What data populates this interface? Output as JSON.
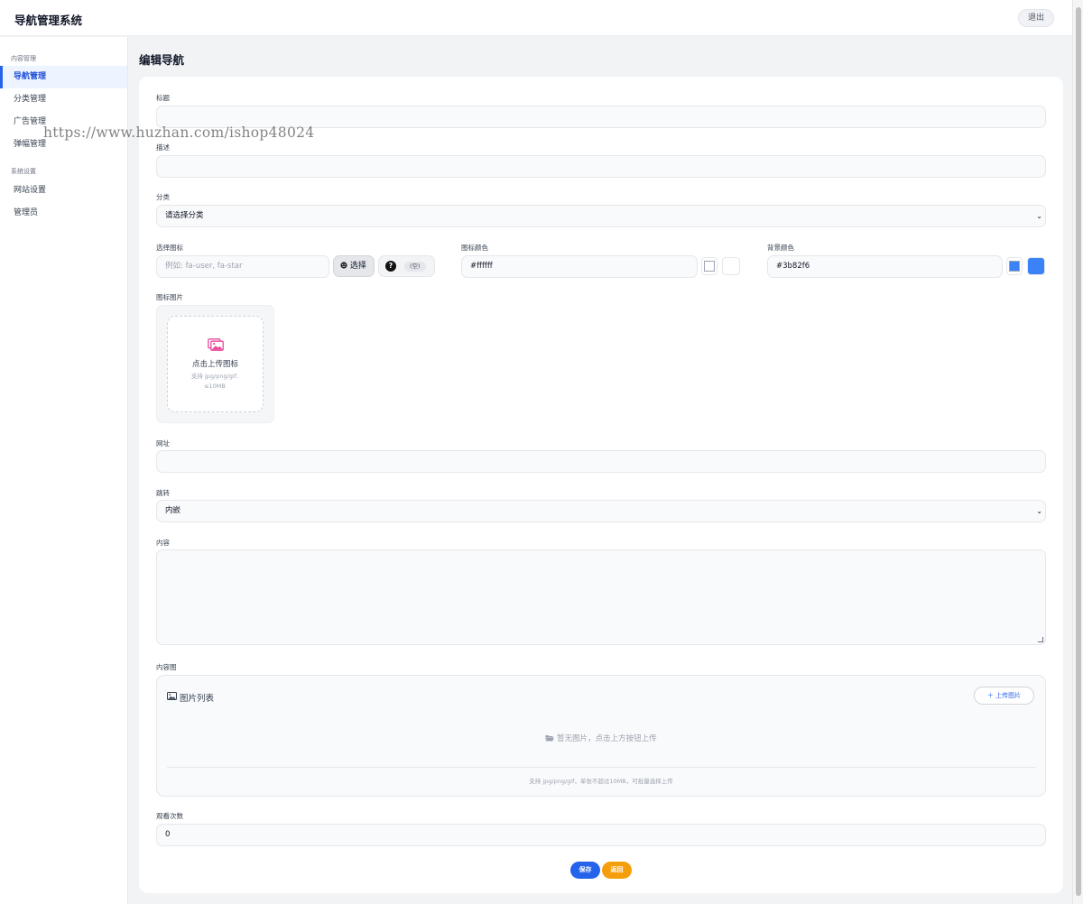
{
  "app": {
    "title": "导航管理系统",
    "logout_label": "退出"
  },
  "sidebar": {
    "groups": [
      {
        "label": "内容管理",
        "items": [
          {
            "label": "导航管理",
            "active": true
          },
          {
            "label": "分类管理"
          },
          {
            "label": "广告管理"
          },
          {
            "label": "弹幅管理"
          }
        ]
      },
      {
        "label": "系统设置",
        "items": [
          {
            "label": "网站设置"
          },
          {
            "label": "管理员"
          }
        ]
      }
    ]
  },
  "watermark": "https://www.huzhan.com/ishop48024",
  "page": {
    "title": "编辑导航"
  },
  "form": {
    "title_label": "标题",
    "title_value": "",
    "desc_label": "描述",
    "desc_value": "",
    "category_label": "分类",
    "category_value": "请选择分类",
    "icon_label": "选择图标",
    "icon_placeholder": "例如: fa-user, fa-star",
    "icon_select_label": "选择",
    "icon_preview_text": "(空)",
    "icon_color_label": "图标颜色",
    "icon_color_value": "#ffffff",
    "icon_color_swatch": "#ffffff",
    "bg_color_label": "背景颜色",
    "bg_color_value": "#3b82f6",
    "bg_color_swatch": "#3b82f6",
    "icon_image_label": "图标图片",
    "upload_text": "点击上传图标",
    "upload_hint": "支持 jpg/png/gif, ≤10MB",
    "url_label": "网址",
    "url_value": "",
    "jump_label": "跳转",
    "jump_value": "内嵌",
    "content_label": "内容",
    "content_images_label": "内容图",
    "gallery_title": "图片列表",
    "gallery_upload_label": "上传图片",
    "gallery_empty": "暂无图片，点击上方按钮上传",
    "gallery_hint": "支持 jpg/png/gif，单张不超过10MB，可批量选择上传",
    "views_label": "观看次数",
    "views_value": "0"
  },
  "actions": {
    "save_label": "保存",
    "back_label": "返回"
  },
  "colors": {
    "primary": "#2563eb",
    "warning": "#f59e0b",
    "accent_pink": "#ec4899"
  }
}
